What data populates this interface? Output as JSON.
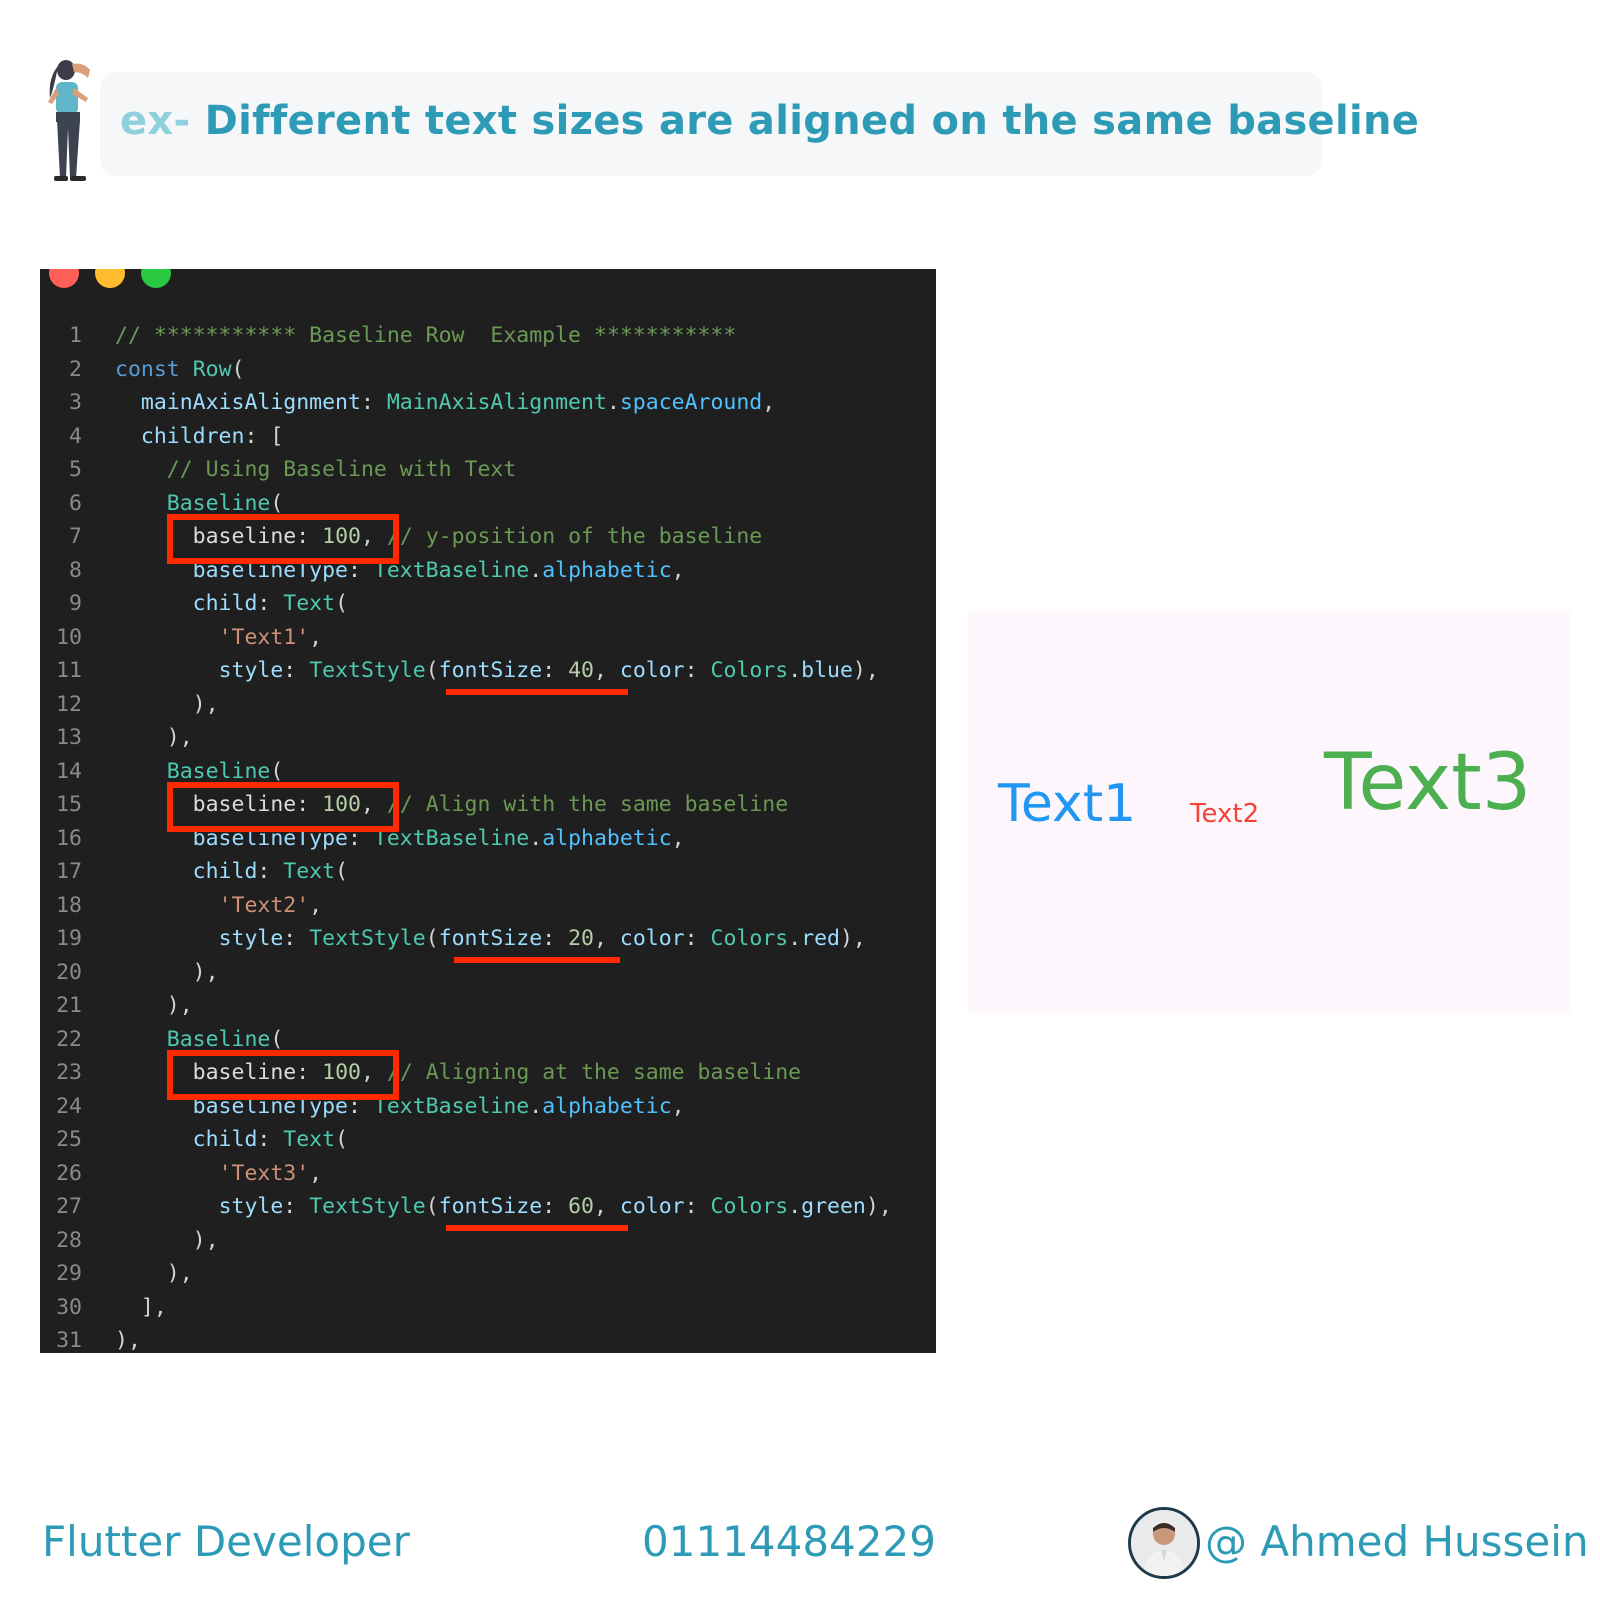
{
  "header": {
    "prefix": "ex-",
    "title": "Different text sizes are aligned on the same baseline"
  },
  "code": {
    "line_numbers": [
      "1",
      "2",
      "3",
      "4",
      "5",
      "6",
      "7",
      "8",
      "9",
      "10",
      "11",
      "12",
      "13",
      "14",
      "15",
      "16",
      "17",
      "18",
      "19",
      "20",
      "21",
      "22",
      "23",
      "24",
      "25",
      "26",
      "27",
      "28",
      "29",
      "30",
      "31"
    ],
    "comment_header": "// *********** Baseline Row  Example ***********",
    "kw_const": "const",
    "cls_row": "Row",
    "paren_open": "(",
    "prop_main_axis": "mainAxisAlignment",
    "colon_space": ": ",
    "cls_main_axis": "MainAxisAlignment",
    "dot": ".",
    "enum_space_around": "spaceAround",
    "comma": ",",
    "prop_children": "children",
    "bracket_open": "[",
    "comment_using": "// Using Baseline with Text",
    "cls_baseline": "Baseline",
    "prop_baseline": "baseline",
    "num_baseline": "100",
    "comment_1": "// y-position of the baseline",
    "comment_2": "// Align with the same baseline",
    "comment_3": "// Aligning at the same baseline",
    "prop_baseline_type": "baselineType",
    "cls_text_baseline": "TextBaseline",
    "enum_alphabetic": "alphabetic",
    "prop_child": "child",
    "cls_text": "Text",
    "str_text1": "'Text1'",
    "str_text2": "'Text2'",
    "str_text3": "'Text3'",
    "prop_style": "style",
    "cls_text_style": "TextStyle",
    "prop_font_size": "fontSize",
    "num_40": "40",
    "num_20": "20",
    "num_60": "60",
    "prop_color": "color",
    "cls_colors": "Colors",
    "enum_blue": "blue",
    "enum_red": "red",
    "enum_green": "green",
    "close_paren_comma": "),",
    "close_bracket_comma": "],"
  },
  "preview": {
    "text1": "Text1",
    "text2": "Text2",
    "text3": "Text3",
    "colors": {
      "text1": "#2196f3",
      "text2": "#f44336",
      "text3": "#4caf50"
    }
  },
  "footer": {
    "role": "Flutter Developer",
    "phone": "01114484229",
    "handle": "@ Ahmed Hussein"
  },
  "accent_color": "#2e9bb6",
  "highlight_color": "#ff2a00"
}
